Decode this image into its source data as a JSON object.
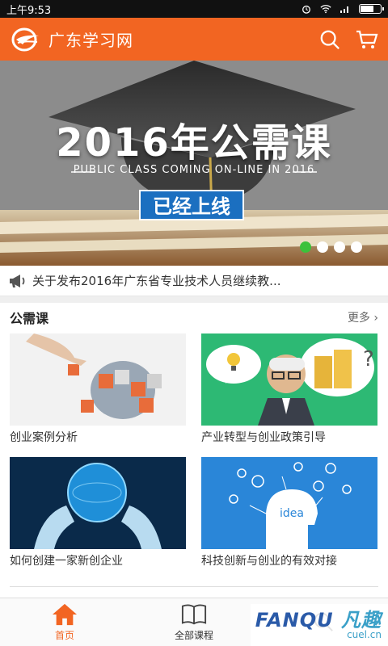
{
  "status_bar": {
    "time": "上午9:53"
  },
  "header": {
    "title": "广东学习网",
    "accent": "#f26522"
  },
  "banner": {
    "title": "2016年公需课",
    "subtitle": "PUBLIC CLASS COMING ON-LINE IN 2016",
    "badge": "已经上线",
    "slides": 4,
    "active_slide": 1
  },
  "notice": {
    "icon": "megaphone-icon",
    "text": "关于发布2016年广东省专业技术人员继续教..."
  },
  "section": {
    "title": "公需课",
    "more": "更多",
    "courses": [
      {
        "title": "创业案例分析"
      },
      {
        "title": "产业转型与创业政策引导"
      },
      {
        "title": "如何创建一家新创企业"
      },
      {
        "title": "科技创新与创业的有效对接"
      }
    ]
  },
  "nav": {
    "items": [
      {
        "label": "首页",
        "icon": "home-icon",
        "active": true
      },
      {
        "label": "全部课程",
        "icon": "book-icon",
        "active": false
      },
      {
        "label": "",
        "icon": "search-icon",
        "active": false
      }
    ]
  },
  "watermark": {
    "brand": "FANQU",
    "brand_cn": "凡趣",
    "site": "cuel.cn"
  }
}
